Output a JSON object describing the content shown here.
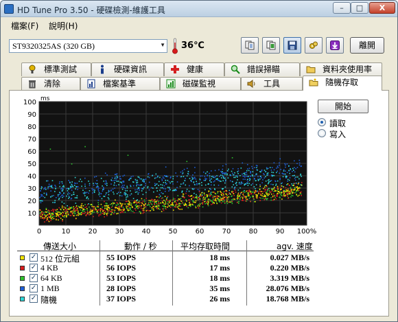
{
  "window": {
    "title": "HD Tune Pro 3.50 - 硬碟檢測-維護工具",
    "min_label": "–",
    "max_label": "□",
    "close_label": "X"
  },
  "menu": [
    {
      "label": "檔案(F)"
    },
    {
      "label": "說明(H)"
    }
  ],
  "toolbar": {
    "drive": "ST9320325AS (320 GB)",
    "temperature": "36℃",
    "buttons": [
      "copy-text-icon",
      "copy-screenshot-icon",
      "save-icon",
      "settings-icon",
      "download-icon"
    ],
    "exit_label": "離開"
  },
  "tabs_row1": [
    {
      "label": "標準測試",
      "icon": "benchmark-icon",
      "color": "#e0b400"
    },
    {
      "label": "硬碟資訊",
      "icon": "info-icon",
      "color": "#1a3c8a"
    },
    {
      "label": "健康",
      "icon": "health-cross-icon",
      "color": "#d42020"
    },
    {
      "label": "錯誤掃瞄",
      "icon": "magnifier-icon",
      "color": "#1a8a1a"
    },
    {
      "label": "資料夾使用率",
      "icon": "folder-icon",
      "color": "#c99a2a"
    }
  ],
  "tabs_row2": [
    {
      "label": "清除",
      "icon": "trash-icon",
      "color": "#555555"
    },
    {
      "label": "檔案基準",
      "icon": "file-benchmark-icon",
      "color": "#1a3c8a"
    },
    {
      "label": "磁碟監視",
      "icon": "disk-monitor-icon",
      "color": "#1a8a1a"
    },
    {
      "label": "工具",
      "icon": "speaker-tools-icon",
      "color": "#c99a2a"
    },
    {
      "label": "隨機存取",
      "icon": "random-access-icon",
      "color": "#e0b400",
      "selected": true
    }
  ],
  "controls": {
    "start_label": "開始",
    "radio_read": "讀取",
    "radio_write": "寫入",
    "selected": "read"
  },
  "table": {
    "headers": {
      "size": "傳送大小",
      "ops": "動作 / 秒",
      "access": "平均存取時間",
      "speed": "agv. 速度"
    },
    "rows": [
      {
        "color": "#f2e400",
        "size": "512 位元組",
        "iops": "55 IOPS",
        "access": "18 ms",
        "speed": "0.027 MB/s"
      },
      {
        "color": "#d81e1e",
        "size": "4 KB",
        "iops": "56 IOPS",
        "access": "17 ms",
        "speed": "0.220 MB/s"
      },
      {
        "color": "#2ec22e",
        "size": "64 KB",
        "iops": "53 IOPS",
        "access": "18 ms",
        "speed": "3.319 MB/s"
      },
      {
        "color": "#1e5fd8",
        "size": "1 MB",
        "iops": "28 IOPS",
        "access": "35 ms",
        "speed": "28.076 MB/s"
      },
      {
        "color": "#2ed6d6",
        "size": "隨機",
        "iops": "37 IOPS",
        "access": "26 ms",
        "speed": "18.768 MB/s"
      }
    ]
  },
  "chart_data": {
    "type": "scatter",
    "ylabel": "ms",
    "y_ticks": [
      "100",
      "90",
      "80",
      "70",
      "60",
      "50",
      "40",
      "30",
      "20",
      "10"
    ],
    "x_ticks": [
      "0",
      "10",
      "20",
      "30",
      "40",
      "50",
      "60",
      "70",
      "80",
      "90",
      "100%"
    ],
    "xlim": [
      0,
      100
    ],
    "ylim": [
      0,
      100
    ],
    "grid": true,
    "background": "#121212",
    "series": [
      {
        "color": "#f2e400",
        "base": [
          8,
          30
        ],
        "spread": 7
      },
      {
        "color": "#d81e1e",
        "base": [
          8,
          30
        ],
        "spread": 7
      },
      {
        "color": "#2ec22e",
        "base": [
          9,
          28
        ],
        "spread": 6
      },
      {
        "color": "#1e5fd8",
        "base": [
          28,
          45
        ],
        "spread": 12
      },
      {
        "color": "#2ed6d6",
        "base": [
          26,
          40
        ],
        "spread": 12
      }
    ]
  }
}
